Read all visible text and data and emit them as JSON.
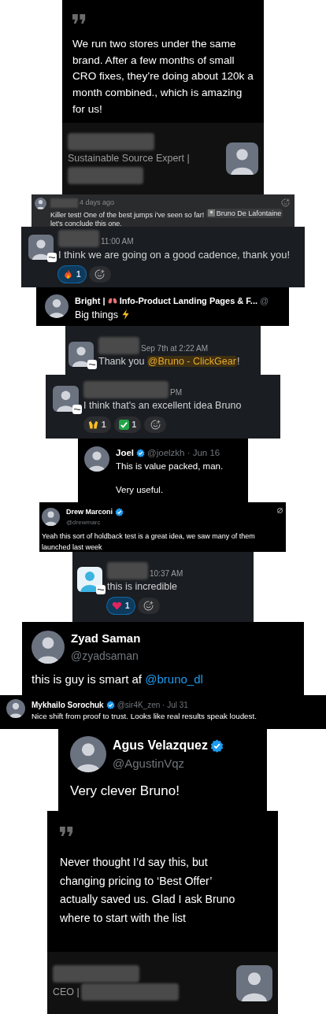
{
  "cards": [
    {
      "kind": "quote",
      "quote": "We run two stores under the same brand. After a few months of small CRO fixes, they’re doing about 120k a month combined., which is amazing for us!",
      "author": [
        {
          "kind": "redacted"
        },
        {
          "kind": "text",
          "text": "Sustainable Source Expert |"
        },
        {
          "kind": "redacted"
        }
      ]
    },
    {
      "kind": "comment",
      "time": "4 days ago",
      "message": [
        {
          "kind": "text",
          "text": "Killer test! One of the best jumps i've seen so far! "
        },
        {
          "kind": "chip",
          "text": "Bruno De Lafontaine"
        },
        {
          "kind": "text",
          "text": " let's conclude this one."
        }
      ]
    },
    {
      "kind": "slack",
      "time": "11:00 AM",
      "message": [
        {
          "kind": "text",
          "text": "I think we are going on a good cadence, thank you!"
        }
      ],
      "reactions": [
        {
          "count": "1",
          "selected": true
        }
      ]
    },
    {
      "kind": "tweet",
      "name": [
        {
          "kind": "text",
          "text": "Bright | "
        },
        {
          "kind": "icon"
        },
        {
          "kind": "text",
          "text": " Info-Product Landing Pages & F..."
        }
      ],
      "verified": false,
      "handle": "@",
      "message": [
        {
          "kind": "text",
          "text": "Big things "
        },
        {
          "kind": "icon"
        }
      ]
    },
    {
      "kind": "slack",
      "time": "Sep 7th at 2:22 AM",
      "message": [
        {
          "kind": "text",
          "text": "Thank you "
        },
        {
          "kind": "mention",
          "text": "@Bruno - ClickGear"
        },
        {
          "kind": "text",
          "text": "!"
        }
      ]
    },
    {
      "kind": "slack",
      "time": "PM",
      "message": [
        {
          "kind": "text",
          "text": "I think that's an excellent idea Bruno"
        }
      ],
      "reactions": [
        {
          "count": "1",
          "selected": false
        },
        {
          "count": "1",
          "selected": false
        }
      ]
    },
    {
      "kind": "tweet",
      "name": [
        {
          "kind": "text",
          "text": "Joel"
        }
      ],
      "verified": true,
      "handle": "@joelzkh · Jun 16",
      "paragraphs": [
        [
          {
            "kind": "text",
            "text": "This is value packed, man."
          }
        ],
        [
          {
            "kind": "text",
            "text": "Very useful."
          }
        ]
      ]
    },
    {
      "kind": "tweet",
      "name": [
        {
          "kind": "text",
          "text": "Drew Marconi"
        }
      ],
      "verified": true,
      "handle": "@drewmarc",
      "message": [
        {
          "kind": "text",
          "text": "Yeah this sort of holdback test is a great idea, we saw many of them launched last week"
        }
      ]
    },
    {
      "kind": "slack",
      "time": "10:37 AM",
      "message": [
        {
          "kind": "text",
          "text": "this is incredible"
        }
      ],
      "reactions": [
        {
          "count": "1",
          "selected": true
        }
      ]
    },
    {
      "kind": "tweet",
      "name": [
        {
          "kind": "text",
          "text": "Zyad Saman"
        }
      ],
      "verified": false,
      "handle": "@zyadsaman",
      "message": [
        {
          "kind": "text",
          "text": "this is guy is smart af "
        },
        {
          "kind": "link",
          "text": "@bruno_dl"
        }
      ]
    },
    {
      "kind": "tweet",
      "name": [
        {
          "kind": "text",
          "text": "Mykhailo Sorochuk"
        }
      ],
      "verified": true,
      "handle": "@sir4K_zen · Jul 31",
      "message": [
        {
          "kind": "text",
          "text": "Nice shift from proof to trust. Looks like real results speak loudest."
        }
      ]
    },
    {
      "kind": "tweet",
      "name": [
        {
          "kind": "text",
          "text": "Agus Velazquez"
        }
      ],
      "verified": true,
      "handle": "@AgustinVqz",
      "message": [
        {
          "kind": "text",
          "text": "Very clever Bruno!"
        }
      ]
    },
    {
      "kind": "quote",
      "quote": "Never thought I’d say this, but changing pricing to ‘Best Offer’ actually saved us. Glad I ask Bruno where to start with the list",
      "author": [
        {
          "kind": "redacted"
        },
        {
          "kind": "text_redacted",
          "text": "CEO |"
        }
      ]
    }
  ]
}
